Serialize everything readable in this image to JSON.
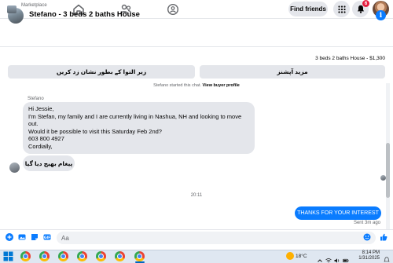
{
  "topnav": {
    "find_friends": "Find friends",
    "notification_count": "6",
    "icons": [
      "home-icon",
      "friends-icon",
      "groups-icon",
      "menu-grid-icon",
      "bell-icon"
    ]
  },
  "chat": {
    "title": "Stefano - 3 beds 2 baths House",
    "info_icon": "i"
  },
  "marketplace": {
    "label": "Marketplace",
    "listing": "3 beds 2 baths House - $1,300",
    "button_left": "زیر التوا کے بطور نشان زد کریں",
    "button_right": "مزید آپشنز"
  },
  "conversation": {
    "started_text": "Stefano started this chat.",
    "view_profile": "View buyer profile",
    "sender_name": "Stefano",
    "message_lines": [
      "Hi Jessie,",
      "I'm Stefan, my family and I are currently living in Nashua, NH and looking to move",
      "out.",
      "Would it be possible to visit this Saturday Feb 2nd?",
      "603 800 4927",
      "Cordially,"
    ],
    "message_2": "پیغام بھیج دیا گیا",
    "time_separator": "20:11",
    "outgoing": "THANKS FOR YOUR INTEREST",
    "sent_status": "Sent 3m ago"
  },
  "composer": {
    "placeholder": "Aa"
  },
  "taskbar": {
    "weather": "18°C",
    "time": "8:14 PM",
    "date": "1/31/2025"
  },
  "colors": {
    "accent": "#0a7cff",
    "bubble_in": "#e4e6eb",
    "badge": "#e41e3f"
  }
}
